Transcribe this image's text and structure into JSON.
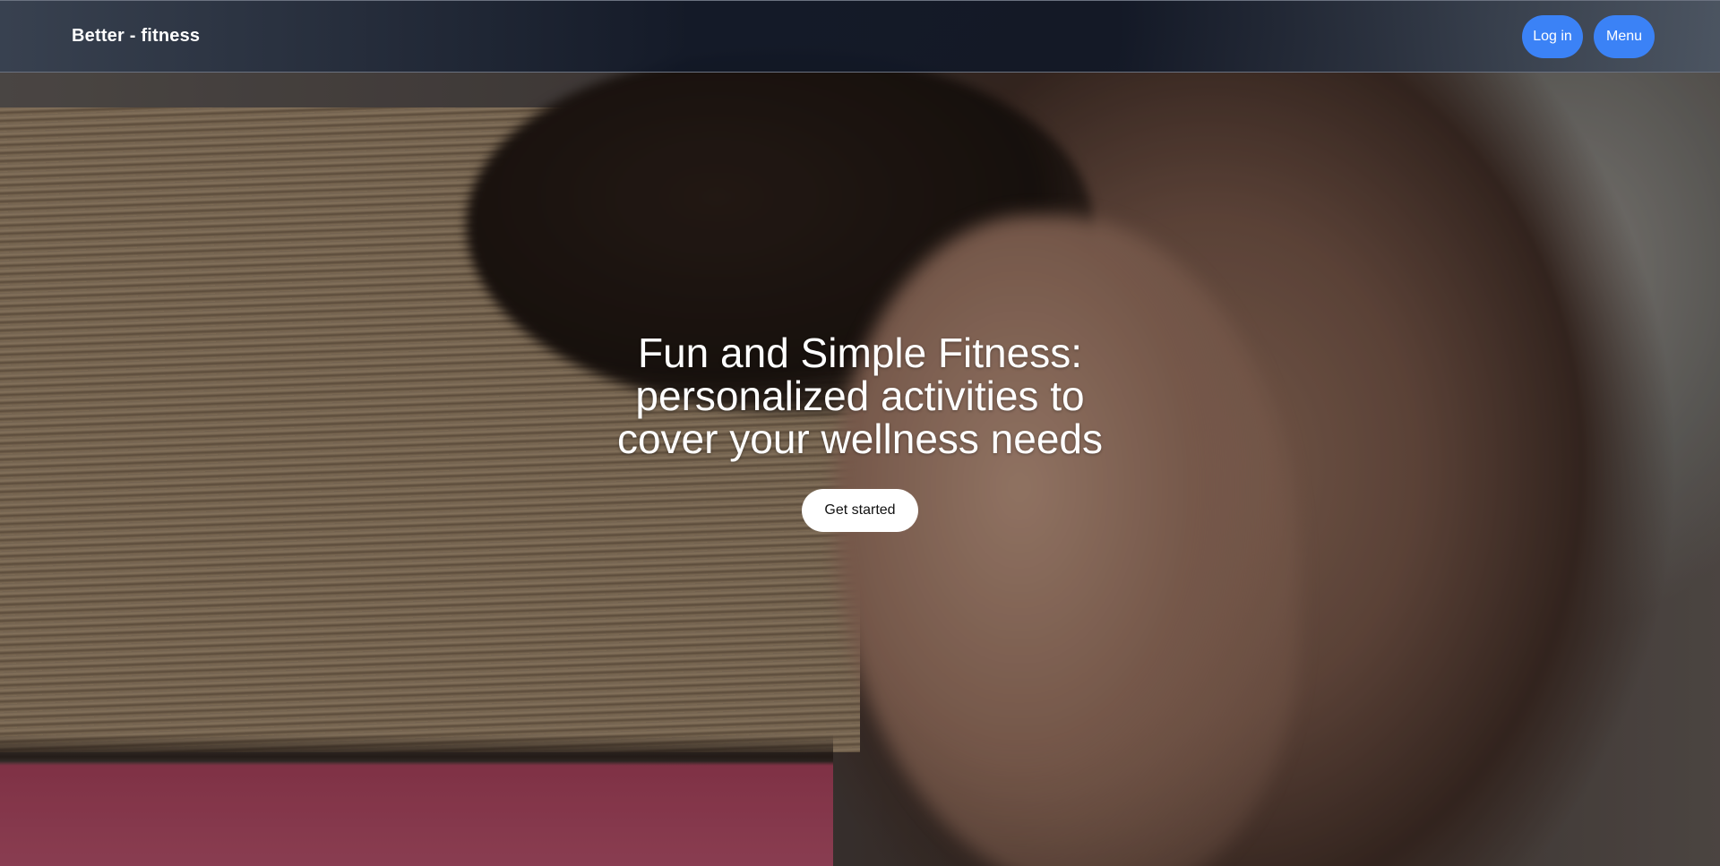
{
  "navbar": {
    "brand": "Better - fitness",
    "login_label": "Log in",
    "menu_label": "Menu"
  },
  "hero": {
    "title": "Fun and Simple Fitness: personalized activities to cover your wellness needs",
    "cta_label": "Get started",
    "background_description_icon": "hero-photo"
  },
  "colors": {
    "accent": "#3b82f6",
    "cta_background": "#ffffff",
    "navbar_background": "#111827"
  }
}
